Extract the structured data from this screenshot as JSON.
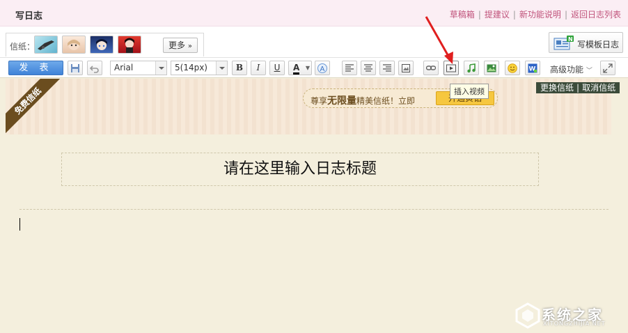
{
  "header": {
    "title": "写日志",
    "links": [
      "草稿箱",
      "提建议",
      "新功能说明",
      "返回日志列表"
    ]
  },
  "paper": {
    "label": "信纸：",
    "more_label": "更多",
    "thumb_colors": [
      "#8ecfe0",
      "#f3d9c4",
      "#2c4a8c",
      "#d0202a"
    ]
  },
  "template_button": {
    "label": "写模板日志"
  },
  "toolbar": {
    "publish_label": "发 表",
    "font_family": "Arial",
    "font_size": "5(14px)",
    "bold": "B",
    "italic": "I",
    "underline": "U",
    "font_color": "A",
    "advanced_label": "高级功能"
  },
  "tooltip": "插入视频",
  "editor": {
    "ribbon_label": "免费信纸",
    "promo": {
      "prefix": "尊享",
      "highlight": "无限量",
      "suffix": "精美信纸！立即",
      "button": "开通黄钻"
    },
    "change_paper": "更换信纸",
    "cancel_paper": "取消信纸",
    "title_placeholder": "请在这里输入日志标题"
  },
  "watermark": {
    "text": "系统之家",
    "url": "XITONGZHIJIA.NET"
  }
}
